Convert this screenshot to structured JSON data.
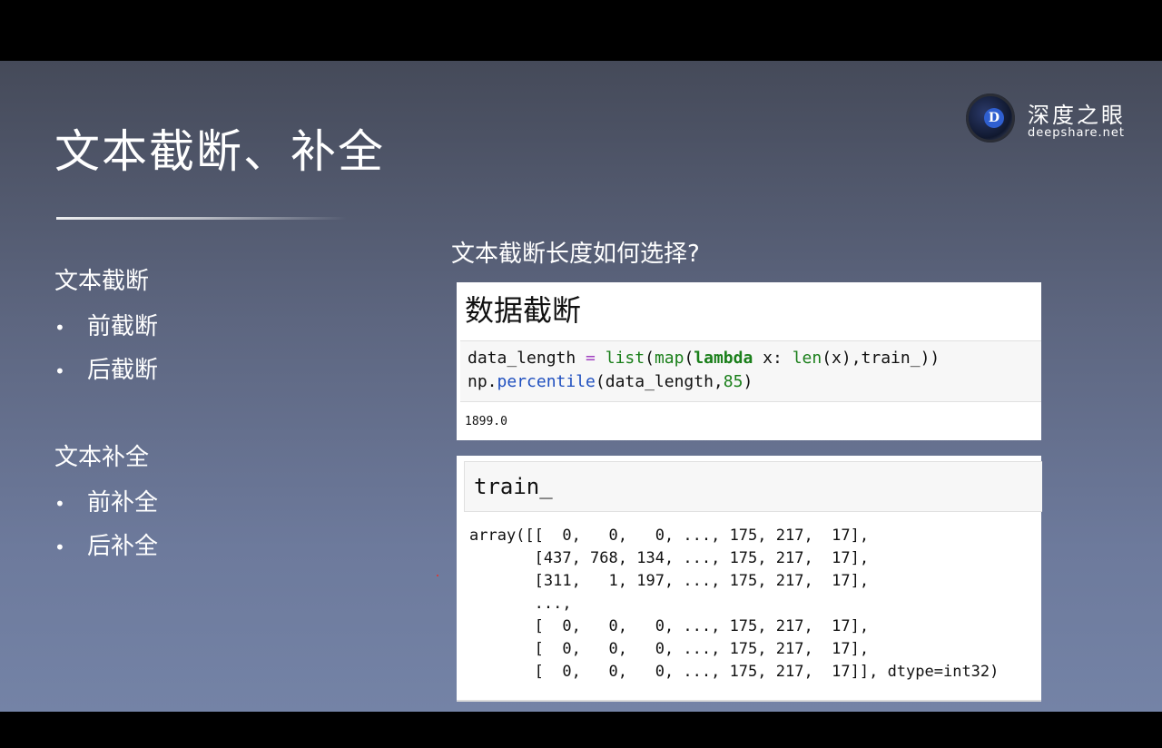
{
  "slide": {
    "title": "文本截断、补全",
    "logo": {
      "cn": "深度之眼",
      "en": "deepshare.net",
      "mark": "D"
    },
    "left": {
      "section1": "文本截断",
      "bullets1": [
        "前截断",
        "后截断"
      ],
      "section2": "文本补全",
      "bullets2": [
        "前补全",
        "后补全"
      ],
      "bullet_glyph": "•"
    },
    "question": "文本截断长度如何选择?",
    "notebook1": {
      "heading": "数据截断",
      "line1": {
        "var": "data_length ",
        "eq": "=",
        "sp": " ",
        "list": "list",
        "p1": "(",
        "map": "map",
        "p2": "(",
        "lambda": "lambda",
        "x": " x: ",
        "len": "len",
        "rest": "(x),train_))"
      },
      "line2": {
        "np": "np.",
        "percentile": "percentile",
        "args": "(data_length,",
        "n85": "85",
        "close": ")"
      },
      "output": "1899.0"
    },
    "notebook2": {
      "input": "train_",
      "output_lines": [
        "array([[  0,   0,   0, ..., 175, 217,  17],",
        "       [437, 768, 134, ..., 175, 217,  17],",
        "       [311,   1, 197, ..., 175, 217,  17],",
        "       ...,",
        "       [  0,   0,   0, ..., 175, 217,  17],",
        "       [  0,   0,   0, ..., 175, 217,  17],",
        "       [  0,   0,   0, ..., 175, 217,  17]], dtype=int32)"
      ]
    }
  }
}
